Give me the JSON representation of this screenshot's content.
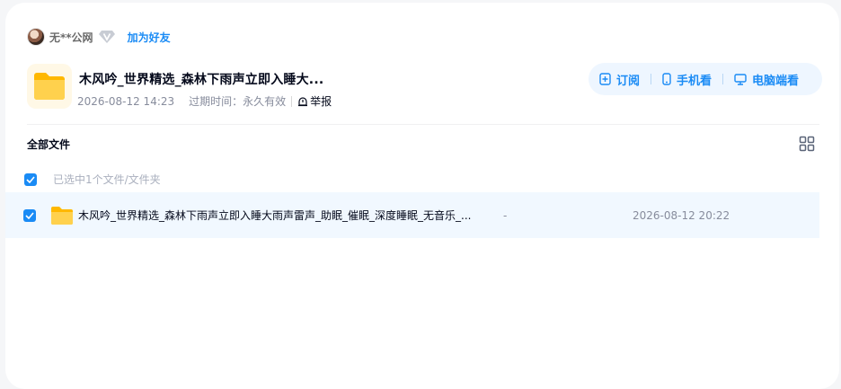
{
  "user": {
    "name": "无**公网",
    "vip_icon": "diamond-v-icon",
    "add_friend_label": "加为好友"
  },
  "share": {
    "title": "木风吟_世界精选_森林下雨声立即入睡大...",
    "date": "2026-08-12 14:23",
    "expire_label": "过期时间：",
    "expire_value": "永久有效",
    "report_label": "举报",
    "folder_icon": "folder-icon"
  },
  "actions": [
    {
      "label": "订阅",
      "icon": "subscribe-icon"
    },
    {
      "label": "手机看",
      "icon": "phone-icon"
    },
    {
      "label": "电脑端看",
      "icon": "monitor-icon"
    }
  ],
  "list": {
    "breadcrumb": "全部文件",
    "selected_text": "已选中1个文件/文件夹",
    "rows": [
      {
        "name": "木风吟_世界精选_森林下雨声立即入睡大雨声雷声_助眠_催眠_深度睡眠_无音乐_...",
        "size": "-",
        "time": "2026-08-12 20:22",
        "checked": true
      }
    ]
  },
  "colors": {
    "accent": "#1a8bf5",
    "row_highlight": "#f1f8ff",
    "folder": "#ffc933"
  }
}
